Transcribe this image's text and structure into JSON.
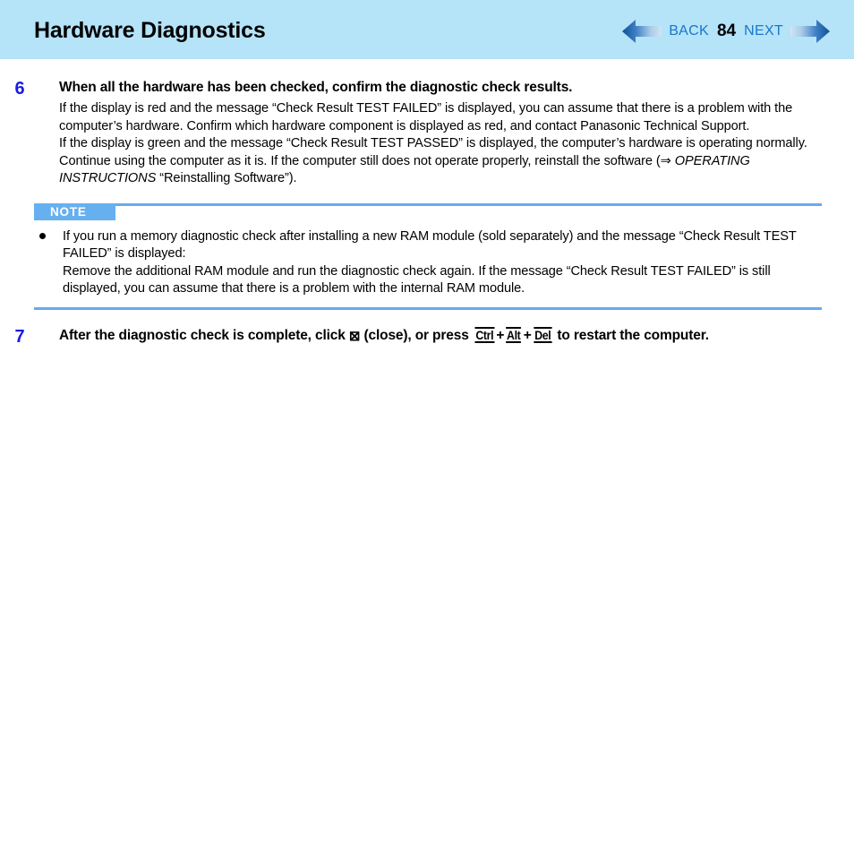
{
  "header": {
    "title": "Hardware Diagnostics",
    "nav": {
      "back_label": "BACK",
      "page_number": "84",
      "next_label": "NEXT",
      "back_icon": "arrow-left-icon",
      "next_icon": "arrow-right-icon",
      "label_color": "#1878c8",
      "band_color": "#b5e3f8"
    }
  },
  "steps": [
    {
      "number": "6",
      "title": "When all the hardware has been checked, confirm the diagnostic check results.",
      "paragraphs": [
        "If the display is red and the message “Check Result TEST FAILED” is displayed, you can assume that there is a problem with the computer’s hardware. Confirm which hardware component is displayed as red, and contact Panasonic Technical Support.",
        "If the display is green and the message “Check Result TEST PASSED” is displayed, the computer’s hardware is operating normally. Continue using the computer as it is. If the computer still does not operate properly, reinstall the software ("
      ],
      "reference": {
        "arrow": "⇒",
        "italic_title": "OPERATING INSTRUCTIONS",
        "quoted": "“Reinstalling Software”).",
        "tail": ""
      }
    }
  ],
  "note": {
    "label": "NOTE",
    "rule_color": "#66aaee",
    "tab_color": "#67b0f0",
    "items": [
      {
        "lines": [
          "If you run a memory diagnostic check after installing a new RAM module (sold separately) and the message “Check Result TEST FAILED” is displayed:",
          "Remove the additional RAM module and run the diagnostic check again. If the message “Check Result TEST FAILED” is still displayed, you can assume that there is a problem with the internal RAM module."
        ]
      }
    ]
  },
  "step7": {
    "number": "7",
    "text_before_close": "After the diagnostic check is complete, click ",
    "close_icon_glyph": "⊠",
    "text_after_close": "(close), or press ",
    "key1": "Ctrl",
    "plus1": "+",
    "key2": "Alt",
    "plus2": "+",
    "key3": "Del",
    "text_tail": " to restart the computer."
  }
}
